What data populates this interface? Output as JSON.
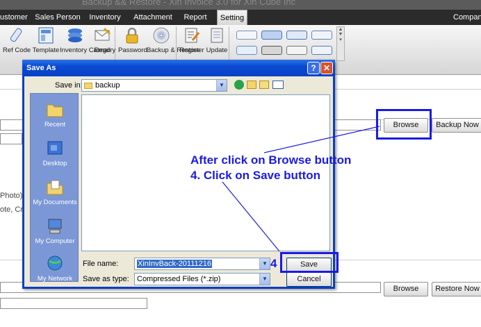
{
  "window": {
    "title": "Backup && Restore - Xin Invoice 3.0 for Xin Cube Inc"
  },
  "menu": {
    "items": [
      {
        "label": "ustomer"
      },
      {
        "label": "Sales Person"
      },
      {
        "label": "Inventory"
      },
      {
        "label": "Attachment"
      },
      {
        "label": "Report"
      },
      {
        "label": "Setting"
      },
      {
        "label": "Company"
      }
    ],
    "active": "Setting"
  },
  "ribbon": {
    "buttons": [
      {
        "label": "Ref Code",
        "icon": "ref-code-icon"
      },
      {
        "label": "Template",
        "icon": "template-icon"
      },
      {
        "label": "Inventory Category",
        "icon": "inventory-category-icon"
      },
      {
        "label": "Email",
        "icon": "email-icon"
      },
      {
        "label": "Password",
        "icon": "lock-icon"
      },
      {
        "label": "Backup & Restore",
        "icon": "disc-icon"
      },
      {
        "label": "Register",
        "icon": "register-icon"
      },
      {
        "label": "Update",
        "icon": "update-icon"
      }
    ]
  },
  "background": {
    "browse_label": "Browse",
    "backup_now_label": "Backup Now",
    "browse2_label": "Browse",
    "restore_now_label": "Restore Now",
    "side_text_1": "Photo)",
    "side_text_2": "ote, Cre"
  },
  "dialog": {
    "title": "Save As",
    "save_in_label": "Save in:",
    "save_in_value": "backup",
    "places": [
      {
        "label": "Recent",
        "icon": "recent-folder-icon"
      },
      {
        "label": "Desktop",
        "icon": "desktop-icon"
      },
      {
        "label": "My Documents",
        "icon": "my-documents-icon"
      },
      {
        "label": "My Computer",
        "icon": "my-computer-icon"
      },
      {
        "label": "My Network",
        "icon": "my-network-icon"
      }
    ],
    "file_name_label": "File name:",
    "file_name_value": "XinInvBack-20111216",
    "save_as_type_label": "Save as type:",
    "save_as_type_value": "Compressed Files (*.zip)",
    "save_label": "Save",
    "cancel_label": "Cancel",
    "help_label": "?",
    "close_label": "✕"
  },
  "annotation": {
    "line1": "After click on Browse   button",
    "line2": "4. Click on Save button",
    "step_number": "4",
    "color": "#1a1ae6"
  }
}
